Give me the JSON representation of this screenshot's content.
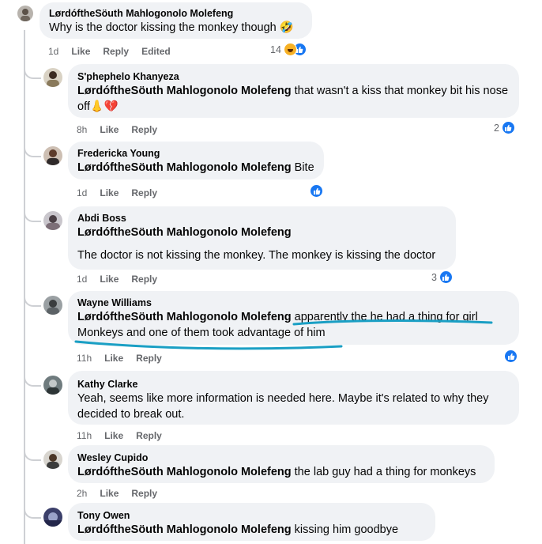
{
  "top_comment": {
    "author": "LørdóftheSöuth Mahlogonolo Molefeng",
    "text": "Why is the doctor kissing the monkey though 🤣",
    "time": "1d",
    "like_label": "Like",
    "reply_label": "Reply",
    "edited_label": "Edited",
    "reaction_count": "14",
    "reactions": [
      "haha",
      "like"
    ]
  },
  "replies": [
    {
      "author": "S'phephelo Khanyeza",
      "mention": "LørdóftheSöuth Mahlogonolo Molefeng",
      "text": "that wasn't a kiss that monkey bit his nose off👃💔",
      "time": "8h",
      "like_label": "Like",
      "reply_label": "Reply",
      "reaction_count": "2"
    },
    {
      "author": "Fredericka Young",
      "mention": "LørdóftheSöuth Mahlogonolo Molefeng",
      "text": "Bite",
      "time": "1d",
      "like_label": "Like",
      "reply_label": "Reply",
      "reaction_count": ""
    },
    {
      "author": "Abdi Boss",
      "mention": "LørdóftheSöuth Mahlogonolo Molefeng",
      "text": "The doctor is not kissing the monkey. The monkey is kissing the doctor",
      "time": "1d",
      "like_label": "Like",
      "reply_label": "Reply",
      "reaction_count": "3"
    },
    {
      "author": "Wayne Williams",
      "mention": "LørdóftheSöuth Mahlogonolo Molefeng",
      "text": "apparently the he had a thing for girl Monkeys and one of them took advantage of him",
      "time": "11h",
      "like_label": "Like",
      "reply_label": "Reply",
      "reaction_count": ""
    },
    {
      "author": "Kathy Clarke",
      "mention": "",
      "text": "Yeah, seems like more information is needed here. Maybe it's related to why they decided to break out.",
      "time": "11h",
      "like_label": "Like",
      "reply_label": "Reply",
      "reaction_count": ""
    },
    {
      "author": "Wesley Cupido",
      "mention": "LørdóftheSöuth Mahlogonolo Molefeng",
      "text": "the lab guy had a thing for monkeys",
      "time": "2h",
      "like_label": "Like",
      "reply_label": "Reply",
      "reaction_count": ""
    },
    {
      "author": "Tony Owen",
      "mention": "LørdóftheSöuth Mahlogonolo Molefeng",
      "text": "kissing him goodbye",
      "time": "",
      "like_label": "",
      "reply_label": "",
      "reaction_count": ""
    }
  ],
  "colors": {
    "bubble": "#f0f2f5",
    "meta_text": "#65676b",
    "like_blue": "#1877f2",
    "annotation": "#1a9fc4"
  },
  "icons": [
    "like-icon",
    "haha-icon"
  ]
}
